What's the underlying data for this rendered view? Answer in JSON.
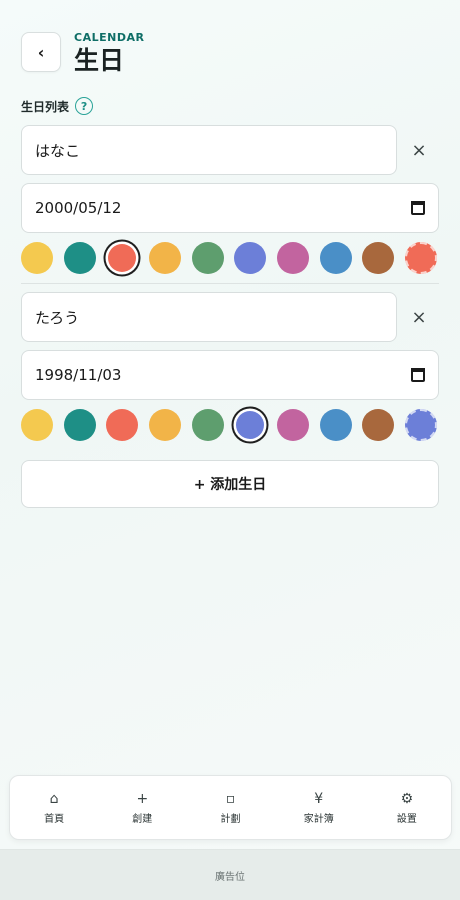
{
  "header": {
    "back_icon": "chevron-left-icon",
    "back_glyph": "‹",
    "eyebrow": "CALENDAR",
    "title": "生日"
  },
  "section": {
    "label": "生日列表",
    "help_glyph": "?"
  },
  "entries": [
    {
      "name": "はなこ",
      "date": "2000/05/12",
      "remove_glyph": "×",
      "selected_color_index": 2,
      "colors": [
        "#f4c94f",
        "#1e8f86",
        "#f06b57",
        "#f2b448",
        "#5e9e6e",
        "#6c7fd8",
        "#c2649f",
        "#4a8fc7",
        "#a8683d"
      ],
      "preview_color": "#f06b57"
    },
    {
      "name": "たろう",
      "date": "1998/11/03",
      "remove_glyph": "×",
      "selected_color_index": 5,
      "colors": [
        "#f4c94f",
        "#1e8f86",
        "#f06b57",
        "#f2b448",
        "#5e9e6e",
        "#6c7fd8",
        "#c2649f",
        "#4a8fc7",
        "#a8683d"
      ],
      "preview_color": "#6c7fd8"
    }
  ],
  "add_button": {
    "label": "+ 添加生日"
  },
  "bottom_nav": [
    {
      "icon": "home-icon",
      "glyph": "⌂",
      "label": "首頁"
    },
    {
      "icon": "plus-icon",
      "glyph": "+",
      "label": "創建"
    },
    {
      "icon": "square-icon",
      "glyph": "▫",
      "label": "計劃"
    },
    {
      "icon": "yen-icon",
      "glyph": "¥",
      "label": "家計簿"
    },
    {
      "icon": "gear-icon",
      "glyph": "⚙",
      "label": "設置"
    }
  ],
  "ad": {
    "label": "廣告位"
  }
}
